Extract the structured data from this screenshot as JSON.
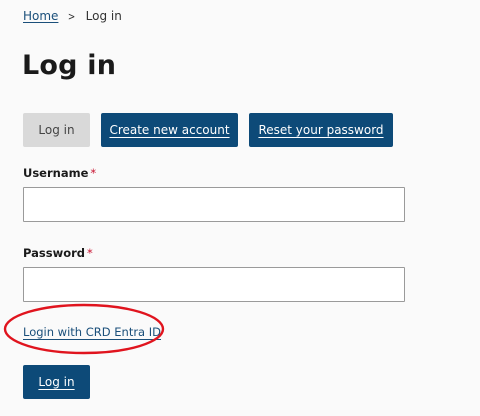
{
  "breadcrumb": {
    "home": "Home",
    "separator": ">",
    "current": "Log in"
  },
  "page_title": "Log in",
  "tabs": [
    {
      "label": "Log in",
      "active": false
    },
    {
      "label": "Create new account",
      "active": true
    },
    {
      "label": "Reset your password",
      "active": true
    }
  ],
  "form": {
    "username_label": "Username",
    "username_value": "",
    "password_label": "Password",
    "password_value": "",
    "required_marker": "*",
    "sso_link": "Login with CRD Entra ID",
    "submit_label": "Log in"
  },
  "annotation": {
    "highlight_color": "#e0141e"
  },
  "colors": {
    "primary": "#0d4a78",
    "link": "#1a4f7a",
    "required": "#c8102e",
    "inactive_tab": "#d9d9d9"
  }
}
